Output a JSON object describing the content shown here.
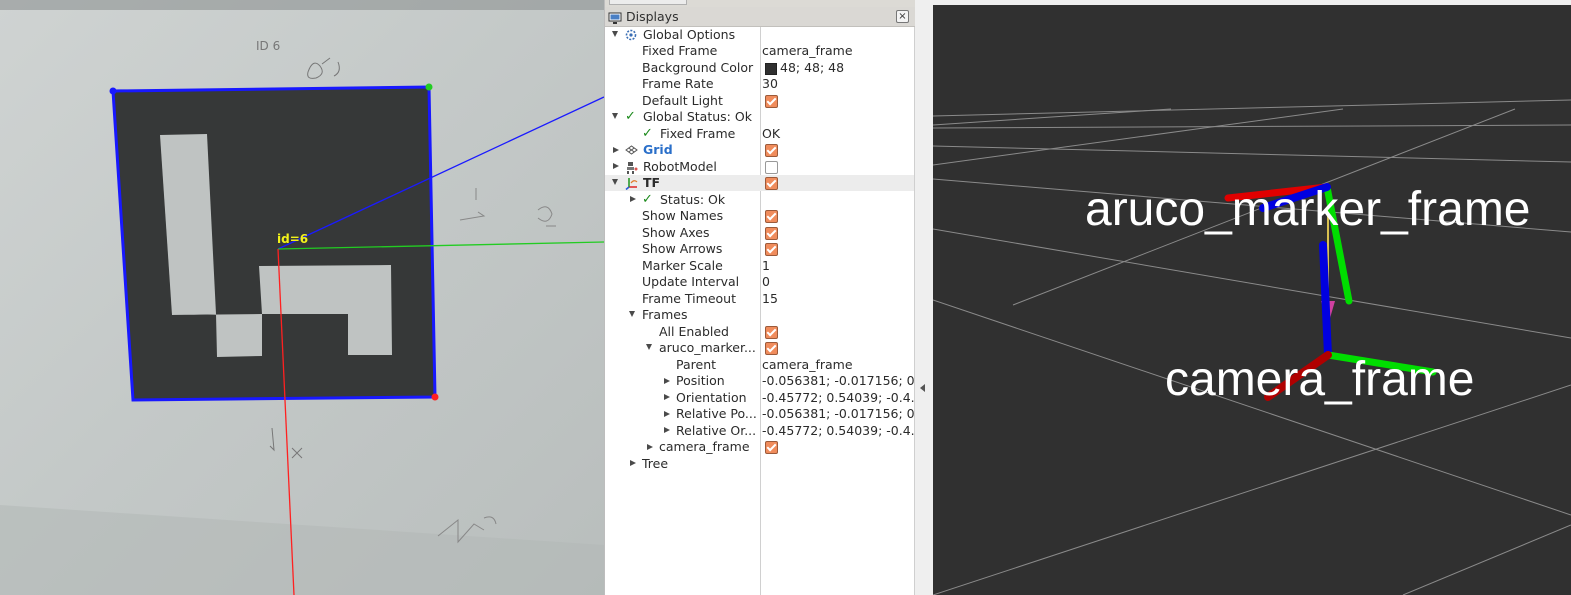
{
  "camera_view": {
    "marker_text_top": "ID 6",
    "marker_id_label": "id=6"
  },
  "displays_panel": {
    "title": "Displays",
    "close_label": "×",
    "rows": [
      {
        "label": "Global Options",
        "value": ""
      },
      {
        "label": "Fixed Frame",
        "value": "camera_frame"
      },
      {
        "label": "Background Color",
        "value": "48; 48; 48"
      },
      {
        "label": "Frame Rate",
        "value": "30"
      },
      {
        "label": "Default Light",
        "value": ""
      },
      {
        "label": "Global Status: Ok",
        "value": ""
      },
      {
        "label": "Fixed Frame",
        "value": "OK"
      },
      {
        "label": "Grid",
        "value": ""
      },
      {
        "label": "RobotModel",
        "value": ""
      },
      {
        "label": "TF",
        "value": ""
      },
      {
        "label": "Status: Ok",
        "value": ""
      },
      {
        "label": "Show Names",
        "value": ""
      },
      {
        "label": "Show Axes",
        "value": ""
      },
      {
        "label": "Show Arrows",
        "value": ""
      },
      {
        "label": "Marker Scale",
        "value": "1"
      },
      {
        "label": "Update Interval",
        "value": "0"
      },
      {
        "label": "Frame Timeout",
        "value": "15"
      },
      {
        "label": "Frames",
        "value": ""
      },
      {
        "label": "All Enabled",
        "value": ""
      },
      {
        "label": "aruco_marker...",
        "value": ""
      },
      {
        "label": "Parent",
        "value": "camera_frame"
      },
      {
        "label": "Position",
        "value": "-0.056381; -0.017156; 0..."
      },
      {
        "label": "Orientation",
        "value": "-0.45772; 0.54039; -0.4..."
      },
      {
        "label": "Relative Po...",
        "value": "-0.056381; -0.017156; 0..."
      },
      {
        "label": "Relative Or...",
        "value": "-0.45772; 0.54039; -0.4..."
      },
      {
        "label": "camera_frame",
        "value": ""
      },
      {
        "label": "Tree",
        "value": ""
      }
    ],
    "checkboxes": {
      "default_light": true,
      "grid": true,
      "robot_model": false,
      "tf": true,
      "show_names": true,
      "show_axes": true,
      "show_arrows": true,
      "all_enabled": true,
      "aruco_marker": true,
      "camera_frame": true
    },
    "background_color_swatch": "#303030"
  },
  "view3d": {
    "background": "#303030",
    "label_marker": "aruco_marker_frame",
    "label_camera": "camera_frame",
    "axis_colors": {
      "x": "#e00000",
      "y": "#00e000",
      "z": "#0000e0"
    }
  }
}
